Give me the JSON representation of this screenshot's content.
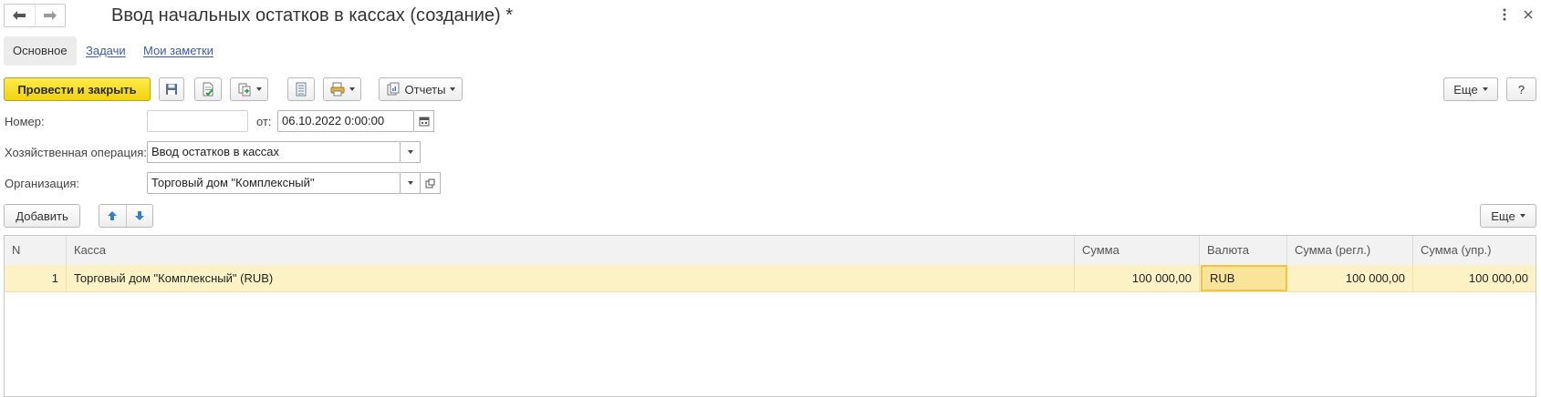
{
  "window": {
    "title": "Ввод начальных остатков в кассах (создание) *"
  },
  "tabs": [
    {
      "label": "Основное",
      "active": true
    },
    {
      "label": "Задачи",
      "active": false
    },
    {
      "label": "Мои заметки",
      "active": false
    }
  ],
  "toolbar": {
    "post_close_label": "Провести и закрыть",
    "reports_label": "Отчеты",
    "more_label": "Еще",
    "help_label": "?"
  },
  "form": {
    "number_label": "Номер:",
    "number_value": "",
    "date_label": "от:",
    "date_value": "06.10.2022  0:00:00",
    "operation_label": "Хозяйственная операция:",
    "operation_value": "Ввод остатков в кассах",
    "org_label": "Организация:",
    "org_value": "Торговый дом \"Комплексный\""
  },
  "table_toolbar": {
    "add_label": "Добавить",
    "more_label": "Еще"
  },
  "table": {
    "headers": [
      "N",
      "Касса",
      "Сумма",
      "Валюта",
      "Сумма (регл.)",
      "Сумма (упр.)"
    ],
    "rows": [
      {
        "n": "1",
        "kassa": "Торговый дом \"Комплексный\" (RUB)",
        "summa": "100 000,00",
        "valuta": "RUB",
        "summa_regl": "100 000,00",
        "summa_upr": "100 000,00"
      }
    ]
  },
  "icons": {
    "back": "arrow-left-icon",
    "forward": "arrow-right-icon",
    "menu": "kebab-menu-icon",
    "close": "close-icon",
    "save": "floppy-disk-icon",
    "post": "post-document-icon",
    "create_based": "create-based-on-icon",
    "structure": "document-structure-icon",
    "print": "print-icon",
    "reports": "reports-icon",
    "calendar": "calendar-icon",
    "dropdown": "dropdown-arrow-icon",
    "open": "open-form-icon",
    "move_up": "move-up-icon",
    "move_down": "move-down-icon"
  },
  "colors": {
    "primary_button": "#f5d80f",
    "selected_row": "#fdf2c6",
    "selected_cell_border": "#f1c542",
    "link": "#3b5ba5",
    "arrow_blue": "#2f7fd2"
  }
}
